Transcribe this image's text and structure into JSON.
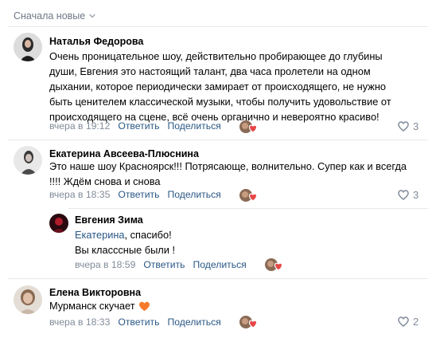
{
  "sort": {
    "label": "Сначала новые"
  },
  "comments": [
    {
      "author": "Наталья Федорова",
      "text_lines": [
        "Очень проницательное шоу, действительно пробирающее до глубины",
        "души, Евгения это настоящий талант, два часа пролетели на одном",
        "дыхании, которое периодически замирает от происходящего, не нужно",
        "быть ценителем классической музыки, чтобы получить удовольствие от",
        "происходящего на сцене, всё очень органично и невероятно красиво!"
      ],
      "time": "вчера в 19:12",
      "reply_label": "Ответить",
      "share_label": "Поделиться",
      "likes": "3"
    },
    {
      "author": "Екатерина Авсеева-Плюснина",
      "text_lines": [
        "Это наше шоу Красноярск!!! Потрясающе, волнительно. Супер как и всегда",
        "!!!! Ждём снова и снова"
      ],
      "time": "вчера в 18:35",
      "reply_label": "Ответить",
      "share_label": "Поделиться",
      "likes": "3"
    },
    {
      "author": "Евгения Зима",
      "mention": "Екатерина",
      "line1_rest": ", спасибо!",
      "line2": "Вы класссные были !",
      "time": "вчера в 18:59",
      "reply_label": "Ответить",
      "share_label": "Поделиться"
    },
    {
      "author": "Елена Викторовна",
      "text": "Мурманск скучает",
      "time": "вчера в 18:33",
      "reply_label": "Ответить",
      "share_label": "Поделиться",
      "likes": "2"
    }
  ],
  "colors": {
    "link": "#2a5885",
    "meta": "#818c99",
    "divider": "#e7e8ec",
    "heart": "#e64646"
  }
}
